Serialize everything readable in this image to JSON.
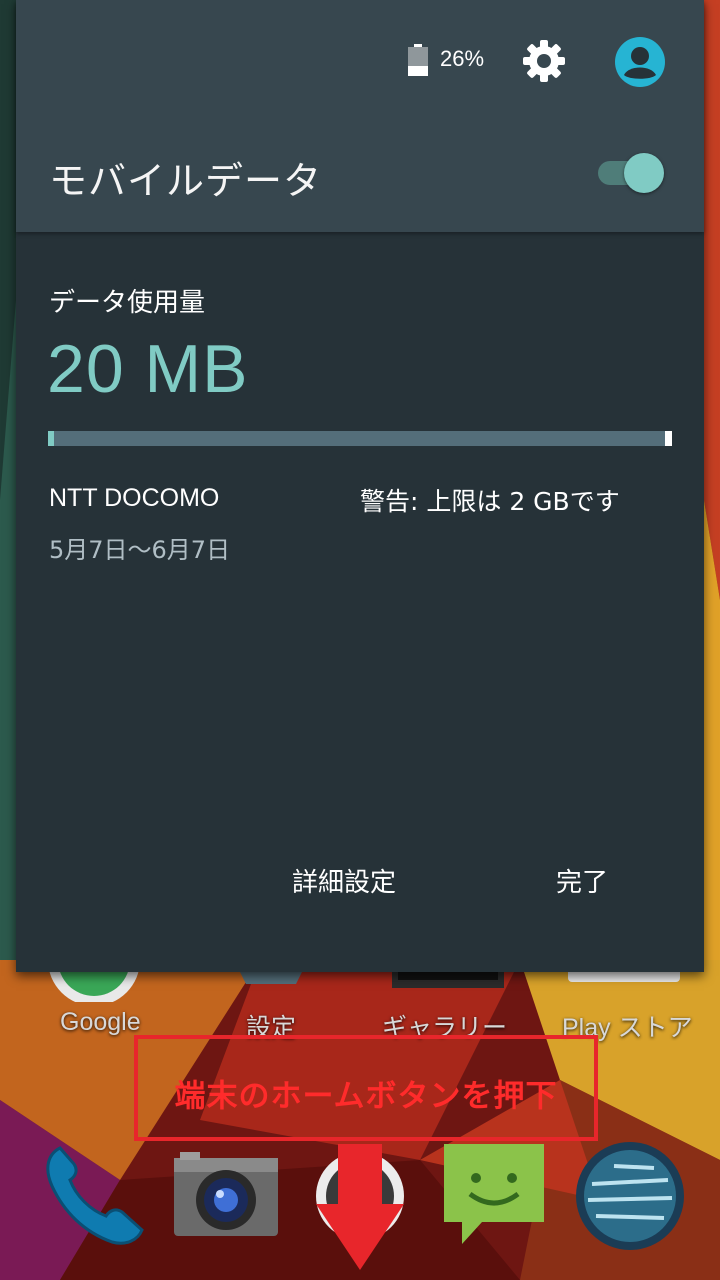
{
  "status": {
    "battery_percent": "26%",
    "battery_icon": "battery-icon",
    "settings_icon": "gear-icon",
    "user_icon": "account-icon"
  },
  "quick_settings": {
    "title": "モバイルデータ",
    "toggle_on": true
  },
  "usage": {
    "label": "データ使用量",
    "value": "20 MB",
    "fraction_used": 0.01,
    "carrier": "NTT DOCOMO",
    "warning": "警告: 上限は 2 GBです",
    "period": "5月7日〜6月7日"
  },
  "buttons": {
    "detail": "詳細設定",
    "done": "完了"
  },
  "home_screen": {
    "apps": [
      "Google",
      "設定",
      "ギャラリー",
      "Play ストア"
    ],
    "dock": [
      "phone-icon",
      "camera-icon",
      "app-drawer-icon",
      "messenger-icon",
      "browser-icon"
    ]
  },
  "annotation": {
    "text": "端末のホームボタンを押下"
  },
  "colors": {
    "accent": "#80cbc4",
    "panel": "#263238",
    "header": "#37474f",
    "annotation_red": "#e8262b"
  }
}
